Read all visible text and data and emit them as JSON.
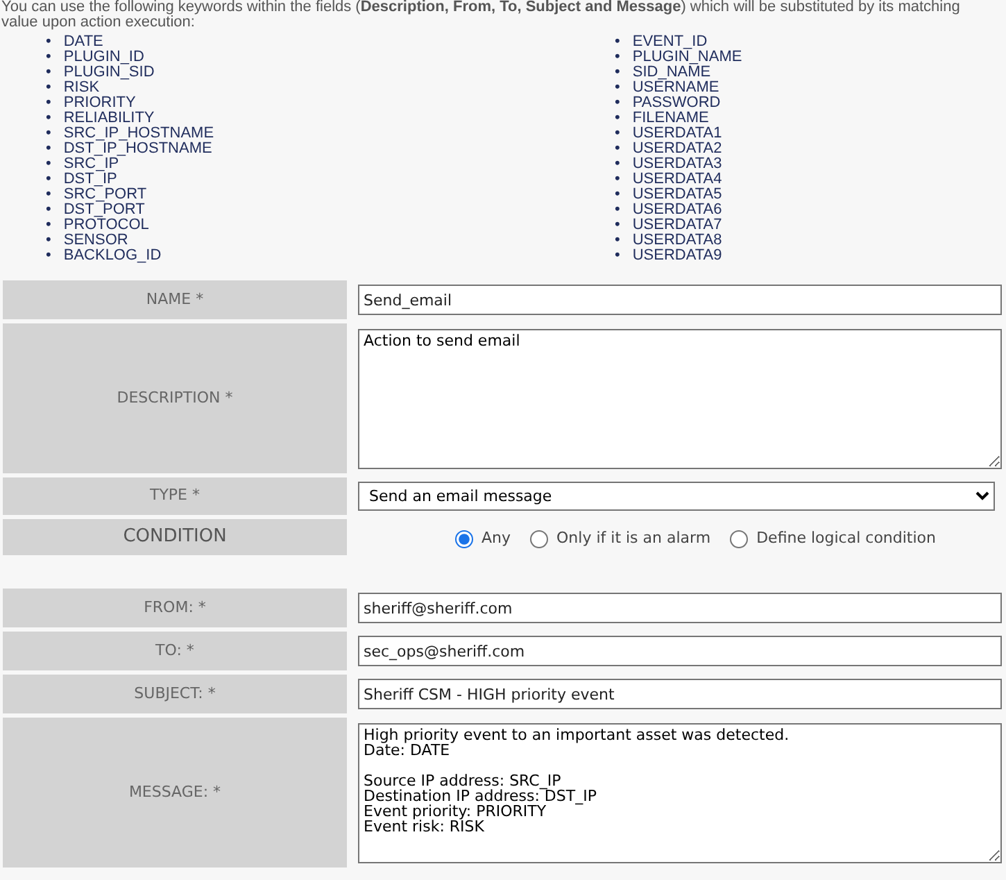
{
  "intro": "You can use the following keywords within the fields (**Description, From, To, Subject and Message**) which will be substituted by its matching value upon action execution:",
  "bullet": "•",
  "keywords": [
    [
      "DATE",
      "PLUGIN_ID",
      "PLUGIN_SID",
      "RISK",
      "PRIORITY",
      "RELIABILITY",
      "SRC_IP_HOSTNAME",
      "DST_IP_HOSTNAME",
      "SRC_IP",
      "DST_IP",
      "SRC_PORT",
      "DST_PORT",
      "PROTOCOL",
      "SENSOR",
      "BACKLOG_ID"
    ],
    [
      "EVENT_ID",
      "PLUGIN_NAME",
      "SID_NAME",
      "USERNAME",
      "PASSWORD",
      "FILENAME",
      "USERDATA1",
      "USERDATA2",
      "USERDATA3",
      "USERDATA4",
      "USERDATA5",
      "USERDATA6",
      "USERDATA7",
      "USERDATA8",
      "USERDATA9"
    ]
  ],
  "sections": [
    {
      "rows": [
        {
          "kind": "input",
          "label": "NAME *",
          "value": "Send_email"
        },
        {
          "kind": "textarea",
          "label": "DESCRIPTION *",
          "value": "Action to send email"
        },
        {
          "kind": "select",
          "label": "TYPE *",
          "value": "Send an email message"
        },
        {
          "kind": "radio",
          "label": "CONDITION",
          "options": [
            {
              "label": "Any",
              "selected": true
            },
            {
              "label": "Only if it is an alarm",
              "selected": false
            },
            {
              "label": "Define logical condition",
              "selected": false
            }
          ]
        }
      ]
    },
    {
      "rows": [
        {
          "kind": "input",
          "label": "FROM: *",
          "value": "sheriff@sheriff.com"
        },
        {
          "kind": "input",
          "label": "TO: *",
          "value": "sec_ops@sheriff.com"
        },
        {
          "kind": "input",
          "label": "SUBJECT: *",
          "value": "Sheriff CSM - HIGH priority event"
        },
        {
          "kind": "textarea",
          "label": "MESSAGE: *",
          "value": "High priority event to an important asset was detected.\nDate: DATE\n\nSource IP address: SRC_IP\nDestination IP address: DST_IP\nEvent priority: PRIORITY\nEvent risk: RISK"
        }
      ]
    }
  ]
}
